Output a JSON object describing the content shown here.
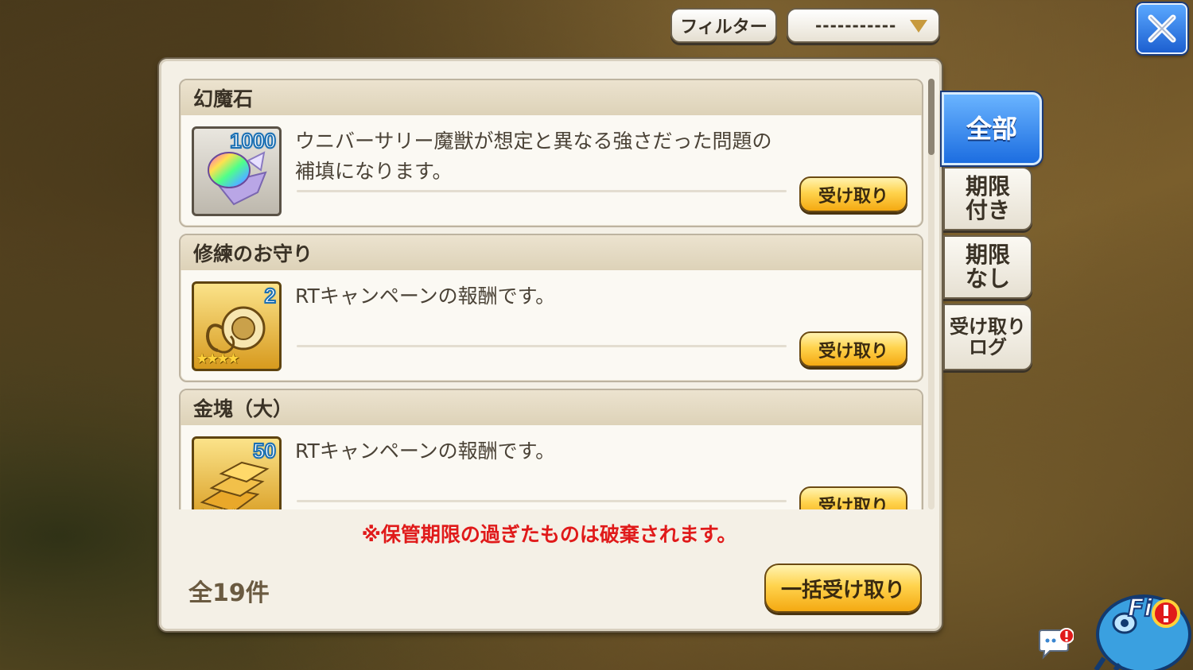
{
  "top": {
    "filter_label": "フィルター",
    "filter_select_value": "-----------"
  },
  "items": [
    {
      "name": "幻魔石",
      "quantity": "1000",
      "description": "ウニバーサリー魔獣が想定と異なる強さだった問題の補填になります。",
      "button_label": "受け取り",
      "icon": "phantom-stone-icon"
    },
    {
      "name": "修練のお守り",
      "quantity": "2",
      "stars": "★★★★",
      "description": "RTキャンペーンの報酬です。",
      "button_label": "受け取り",
      "icon": "training-amulet-icon"
    },
    {
      "name": "金塊（大）",
      "quantity": "50",
      "stars": "★★★★",
      "description": "RTキャンペーンの報酬です。",
      "button_label": "受け取り",
      "icon": "gold-bars-icon"
    }
  ],
  "notice": "※保管期限の過ぎたものは破棄されます。",
  "total_count": "全19件",
  "bulk_receive_label": "一括受け取り",
  "side_tabs": [
    {
      "label": "全部",
      "active": true
    },
    {
      "label": "期限\n付き",
      "active": false
    },
    {
      "label": "期限\nなし",
      "active": false
    },
    {
      "label": "受け取り\nログ",
      "active": false
    }
  ],
  "mascot_label": "Fi",
  "colors": {
    "accent_blue": "#1c6de0",
    "button_gold": "#ffd34d",
    "notice_red": "#e01a1a",
    "panel_bg": "#f4f0e6"
  }
}
